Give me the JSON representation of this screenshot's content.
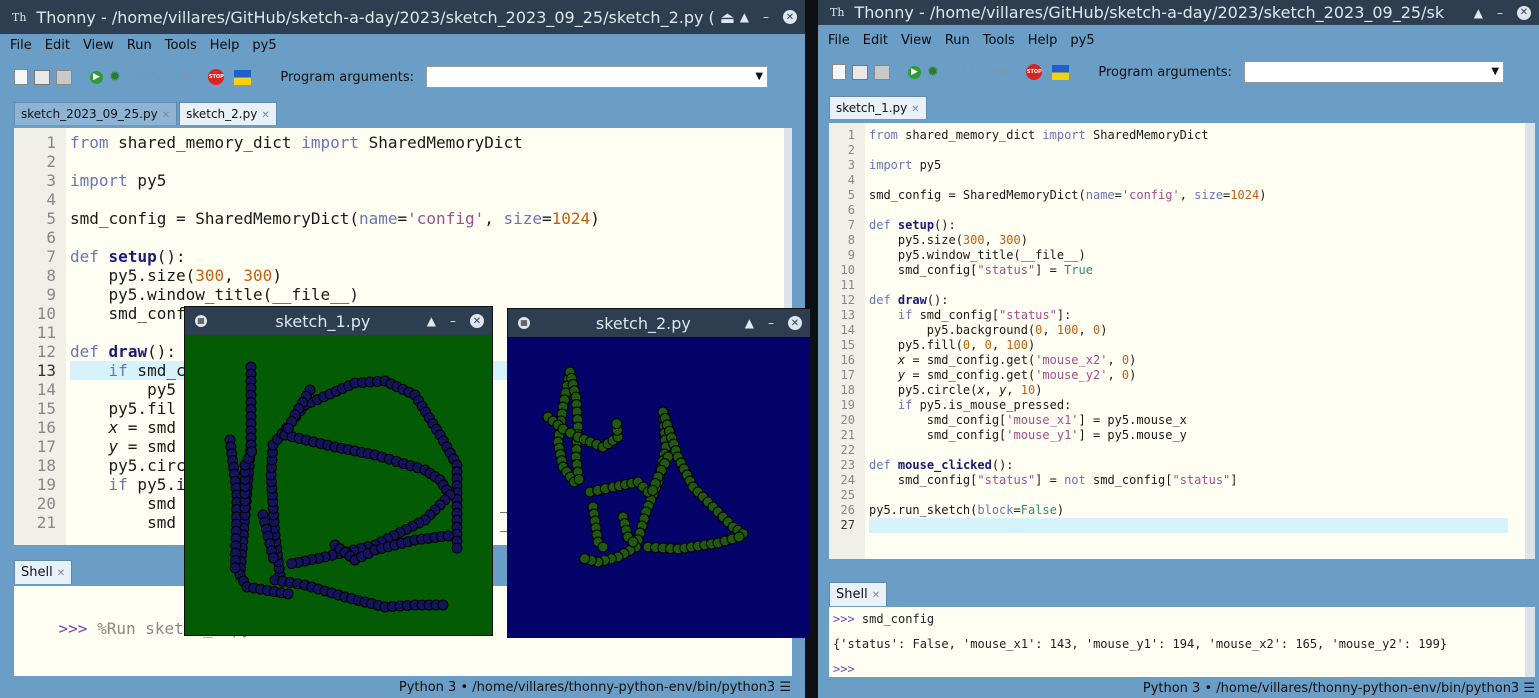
{
  "left_window": {
    "title": "Thonny  -  /home/villares/GitHub/sketch-a-day/2023/sketch_2023_09_25/sketch_2.py  ( ⏏",
    "icon": "Th",
    "tabs": [
      {
        "label": "sketch_2023_09_25.py",
        "active": false
      },
      {
        "label": "sketch_2.py",
        "active": true
      }
    ],
    "shell_tab": "Shell",
    "shell_line": "%Run sketch_2.py",
    "status": "Python 3  •  /home/villares/thonny-python-env/bin/python3 ☰",
    "visible_code_prefix_count": 21
  },
  "right_window": {
    "title": "Thonny  -  /home/villares/GitHub/sketch-a-day/2023/sketch_2023_09_25/sk",
    "icon": "Th",
    "tabs": [
      {
        "label": "sketch_1.py",
        "active": true
      }
    ],
    "shell_tab": "Shell",
    "shell_lines": [
      "smd_config",
      "{'status': False, 'mouse_x1': 143, 'mouse_y1': 194, 'mouse_x2': 165, 'mouse_y2': 199}",
      ""
    ],
    "status": "Python 3  •  /home/villares/thonny-python-env/bin/python3 ☰"
  },
  "menu": [
    "File",
    "Edit",
    "View",
    "Run",
    "Tools",
    "Help",
    "py5"
  ],
  "program_arguments_label": "Program arguments:",
  "prompt": ">>>",
  "code_left": [
    "from shared_memory_dict import SharedMemoryDict",
    "",
    "import py5",
    "",
    "smd_config = SharedMemoryDict(name='config', size=1024)",
    "",
    "def setup():",
    "    py5.size(300, 300)",
    "    py5.window_title(__file__)",
    "    smd_config",
    "",
    "def draw():",
    "    if smd_c",
    "        py5",
    "    py5.fil",
    "    x = smd",
    "    y = smd",
    "    py5.circ",
    "    if py5.i",
    "        smd",
    "        smd"
  ],
  "code_left_tail": {
    "20": "_x",
    "21": "_y"
  },
  "code_right": [
    "from shared_memory_dict import SharedMemoryDict",
    "",
    "import py5",
    "",
    "smd_config = SharedMemoryDict(name='config', size=1024)",
    "",
    "def setup():",
    "    py5.size(300, 300)",
    "    py5.window_title(__file__)",
    "    smd_config[\"status\"] = True",
    "",
    "def draw():",
    "    if smd_config[\"status\"]:",
    "        py5.background(0, 100, 0)",
    "    py5.fill(0, 0, 100)",
    "    x = smd_config.get('mouse_x2', 0)",
    "    y = smd_config.get('mouse_y2', 0)",
    "    py5.circle(x, y, 10)",
    "    if py5.is_mouse_pressed:",
    "        smd_config['mouse_x1'] = py5.mouse_x",
    "        smd_config['mouse_y1'] = py5.mouse_y",
    "",
    "def mouse_clicked():",
    "    smd_config[\"status\"] = not smd_config[\"status\"]",
    "",
    "py5.run_sketch(block=False)",
    ""
  ],
  "sketch_1": {
    "title": "sketch_1.py",
    "background": "#035c03",
    "dot_color": "#14145e"
  },
  "sketch_2": {
    "title": "sketch_2.py",
    "background": "#03036a",
    "dot_color": "#1f5a10"
  },
  "colors": {
    "window_bg": "#6a9ec6",
    "title_bg": "#2c3e50",
    "editor_bg": "#fffef2"
  }
}
